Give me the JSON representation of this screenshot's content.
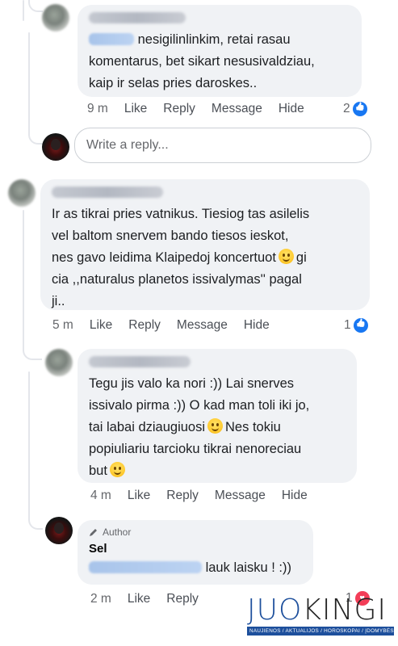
{
  "comments": [
    {
      "text_line1": "nesigilinlinkim, retai rasau",
      "text_line2": "komentarus, bet sikart nesusivaldziau,",
      "text_line3": "kaip ir selas pries daroskes..",
      "time": "9 m",
      "like": "Like",
      "reply": "Reply",
      "message": "Message",
      "hide": "Hide",
      "reactions": "2"
    },
    {
      "text_line1": "Ir as tikrai pries vatnikus. Tiesiog tas asilelis",
      "text_line2": "vel baltom snervem bando tiesos ieskot,",
      "text_line3_a": "nes gavo leidima Klaipedoj koncertuot",
      "text_line3_b": "gi",
      "text_line4": "cia ,,naturalus planetos issivalymas'' pagal",
      "text_line5": "ji..",
      "time": "5 m",
      "like": "Like",
      "reply": "Reply",
      "message": "Message",
      "hide": "Hide",
      "reactions": "1"
    },
    {
      "text_line1": "Tegu jis valo ka nori :)) Lai snerves",
      "text_line2": "issivalo pirma :)) O kad man toli iki jo,",
      "text_line3_a": "tai labai dziaugiuosi",
      "text_line3_b": "Nes tokiu",
      "text_line4": "popiuliariu tarcioku tikrai nenoreciau",
      "text_line5": "but",
      "time": "4 m",
      "like": "Like",
      "reply": "Reply",
      "message": "Message",
      "hide": "Hide"
    },
    {
      "author_badge": "Author",
      "name": "Sel",
      "text": "lauk laisku ! :))",
      "time": "2 m",
      "like": "Like",
      "reply": "Reply",
      "reactions": "1"
    }
  ],
  "reply_box": {
    "placeholder": "Write a reply..."
  },
  "watermark": {
    "logo_a": "JUO",
    "logo_b": "KINGI",
    "tagline": "NAUJIENOS / AKTUALIJOS / HOROSKOPAI / ĮDOMYBĖS"
  },
  "colors": {
    "like_blue": "#1877f2",
    "heart_red": "#f33e58",
    "bubble": "#f0f2f5",
    "brand": "#1d4f9c"
  }
}
